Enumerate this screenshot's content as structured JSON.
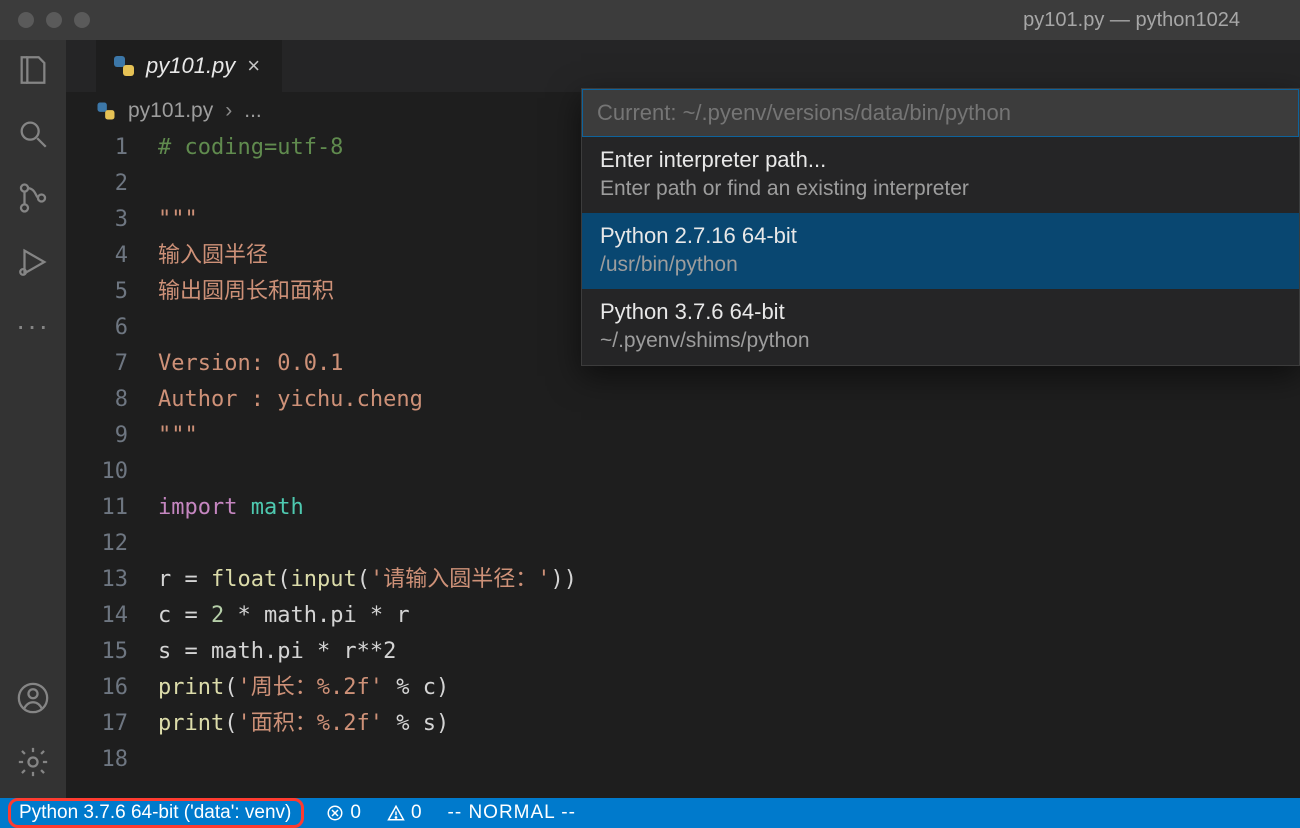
{
  "window": {
    "title": "py101.py — python1024"
  },
  "tab": {
    "filename": "py101.py"
  },
  "breadcrumbs": {
    "filename": "py101.py",
    "separator": "›",
    "rest": "..."
  },
  "code": {
    "lines": [
      {
        "n": "1",
        "kind": "comment",
        "text": "# coding=utf-8"
      },
      {
        "n": "2",
        "kind": "blank",
        "text": ""
      },
      {
        "n": "3",
        "kind": "str",
        "text": "\"\"\""
      },
      {
        "n": "4",
        "kind": "str",
        "text": "输入圆半径"
      },
      {
        "n": "5",
        "kind": "str",
        "text": "输出圆周长和面积"
      },
      {
        "n": "6",
        "kind": "blank",
        "text": ""
      },
      {
        "n": "7",
        "kind": "str",
        "text": "Version: 0.0.1"
      },
      {
        "n": "8",
        "kind": "str",
        "text": "Author : yichu.cheng"
      },
      {
        "n": "9",
        "kind": "str",
        "text": "\"\"\""
      },
      {
        "n": "10",
        "kind": "blank",
        "text": ""
      },
      {
        "n": "11",
        "kind": "import",
        "keyword": "import",
        "module": "math"
      },
      {
        "n": "12",
        "kind": "blank",
        "text": ""
      },
      {
        "n": "13",
        "kind": "assign",
        "lhs": "r = ",
        "call1": "float",
        "paren1": "(",
        "call2": "input",
        "paren2": "(",
        "arg": "'请输入圆半径：'",
        "close": "))"
      },
      {
        "n": "14",
        "kind": "expr",
        "lhs": "c = ",
        "num": "2",
        "mid": " * math.pi * r"
      },
      {
        "n": "15",
        "kind": "plain",
        "text": "s = math.pi * r**2"
      },
      {
        "n": "16",
        "kind": "print",
        "fn": "print",
        "open": "(",
        "arg": "'周长：%.2f'",
        "rest": " % c)"
      },
      {
        "n": "17",
        "kind": "print",
        "fn": "print",
        "open": "(",
        "arg": "'面积：%.2f'",
        "rest": " % s)"
      },
      {
        "n": "18",
        "kind": "blank",
        "text": ""
      }
    ]
  },
  "quickpick": {
    "placeholder": "Current: ~/.pyenv/versions/data/bin/python",
    "items": [
      {
        "title": "Enter interpreter path...",
        "desc": "Enter path or find an existing interpreter",
        "selected": false
      },
      {
        "title": "Python 2.7.16 64-bit",
        "desc": "/usr/bin/python",
        "selected": true
      },
      {
        "title": "Python 3.7.6 64-bit",
        "desc": "~/.pyenv/shims/python",
        "selected": false
      }
    ]
  },
  "statusbar": {
    "python": "Python 3.7.6 64-bit ('data': venv)",
    "errors": "0",
    "warnings": "0",
    "mode": "-- NORMAL --"
  }
}
